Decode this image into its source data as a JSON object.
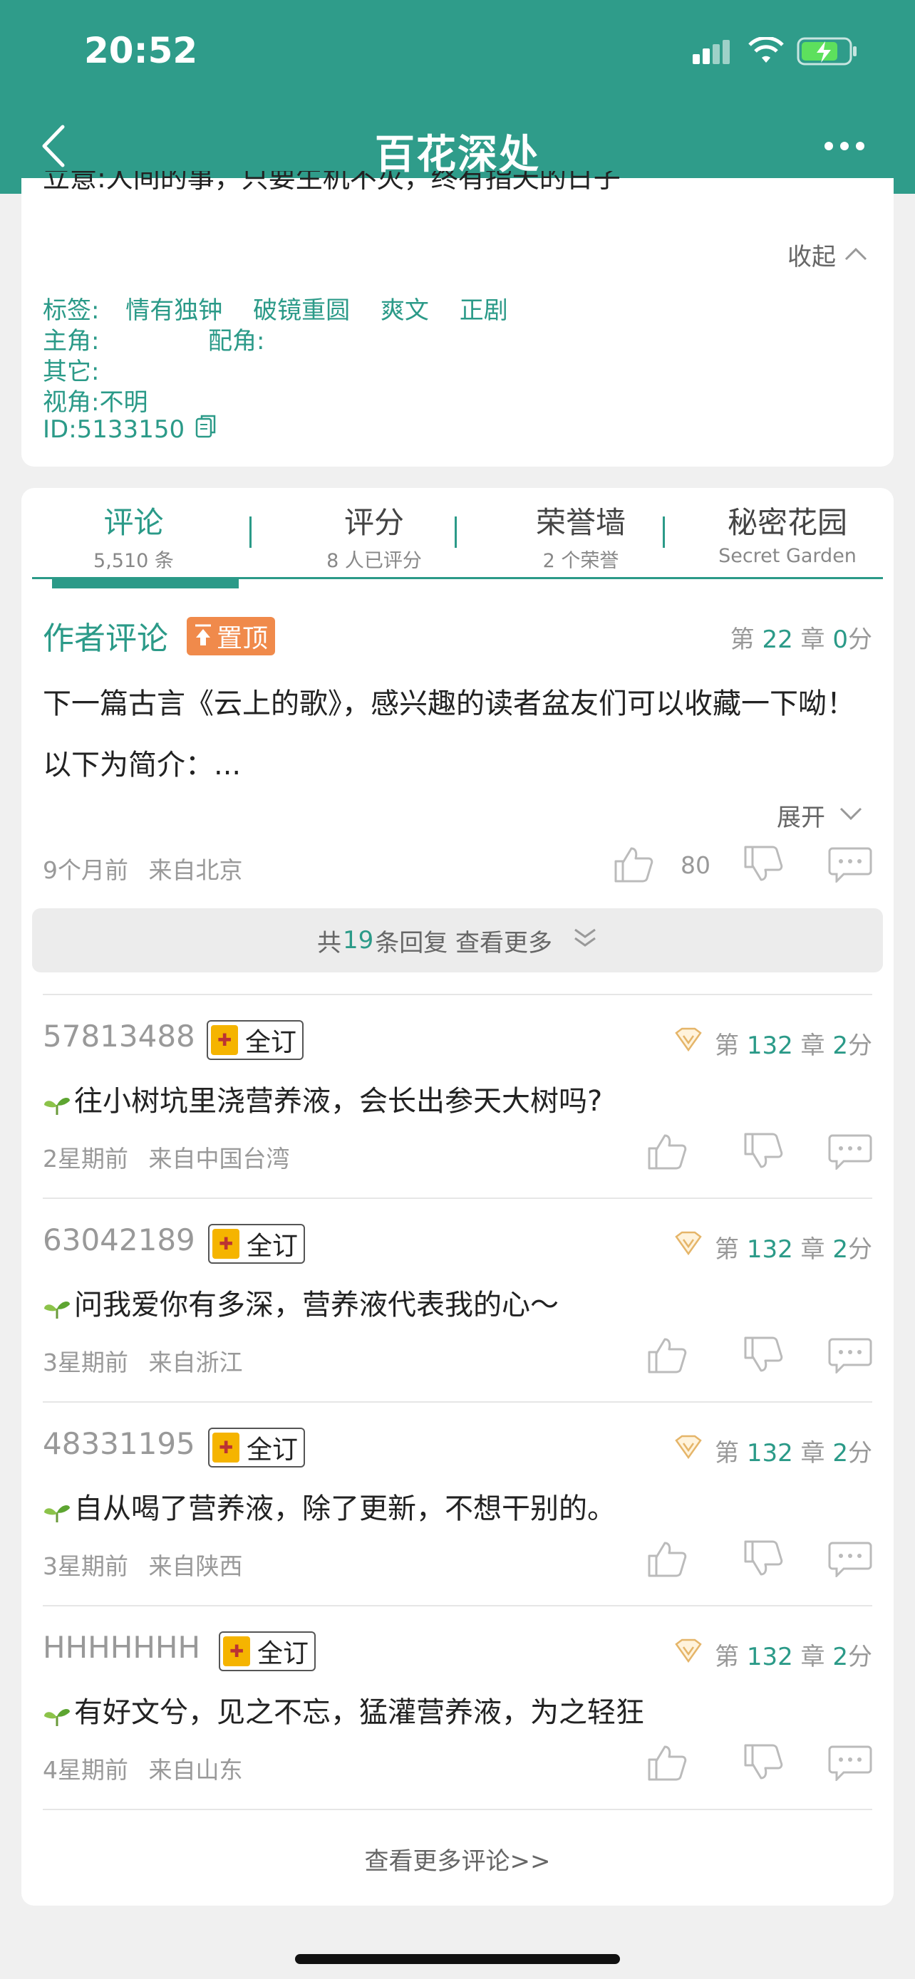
{
  "status": {
    "time": "20:52"
  },
  "nav": {
    "title": "百花深处"
  },
  "info": {
    "truncated_line": "立意:人间的事，只要生机不灭，终有指夭的日子",
    "collapse_label": "收起",
    "tags_label": "标签:",
    "tags": [
      "情有独钟",
      "破镜重圆",
      "爽文",
      "正剧"
    ],
    "protagonist_label": "主角:",
    "supporting_label": "配角:",
    "other_label": "其它:",
    "perspective": "视角:不明",
    "id": "ID:5133150"
  },
  "tabs": [
    {
      "label": "评论",
      "sub": "5,510 条"
    },
    {
      "label": "评分",
      "sub": "8 人已评分"
    },
    {
      "label": "荣誉墙",
      "sub": "2 个荣誉"
    },
    {
      "label": "秘密花园",
      "sub": "Secret Garden"
    }
  ],
  "author_comment": {
    "title": "作者评论",
    "pin_label": "置顶",
    "chapter_prefix": "第",
    "chapter": "22",
    "chapter_suffix": "章",
    "score": "0",
    "score_suffix": "分",
    "text": "下一篇古言《云上的歌》，感兴趣的读者盆友们可以收藏一下呦！以下为简介：...",
    "expand_label": "展开",
    "time": "9个月前",
    "location": "来自北京",
    "likes": "80",
    "replies_prefix": "共",
    "replies_count": "19",
    "replies_suffix": "条回复 查看更多"
  },
  "comments": [
    {
      "user": "57813488",
      "badge": "全订",
      "chapter": "132",
      "score": "2",
      "text": "往小树坑里浇营养液，会长出参天大树吗?",
      "time": "2星期前",
      "location": "来自中国台湾"
    },
    {
      "user": "63042189",
      "badge": "全订",
      "chapter": "132",
      "score": "2",
      "text": "问我爱你有多深，营养液代表我的心～",
      "time": "3星期前",
      "location": "来自浙江"
    },
    {
      "user": "48331195",
      "badge": "全订",
      "chapter": "132",
      "score": "2",
      "text": "自从喝了营养液，除了更新，不想干别的。",
      "time": "3星期前",
      "location": "来自陕西"
    },
    {
      "user": "HHHHHHH",
      "badge": "全订",
      "chapter": "132",
      "score": "2",
      "text": "有好文兮，见之不忘，猛灌营养液，为之轻狂",
      "time": "4星期前",
      "location": "来自山东"
    }
  ],
  "common": {
    "chapter_prefix": "第",
    "chapter_suffix": "章",
    "score_suffix": "分"
  },
  "more_comments": "查看更多评论>>",
  "colors": {
    "brand": "#2f9c8a",
    "accent_green": "#2b9a88",
    "pin_orange": "#f08a4b",
    "badge_gold": "#f5b400"
  },
  "icons": [
    "back-icon",
    "more-icon",
    "signal-icon",
    "wifi-icon",
    "battery-icon",
    "chevron-up-icon",
    "copy-icon",
    "chevron-down-icon",
    "like-icon",
    "dislike-icon",
    "comment-icon",
    "double-chevron-down-icon",
    "vip-diamond-icon",
    "sprout-icon"
  ]
}
